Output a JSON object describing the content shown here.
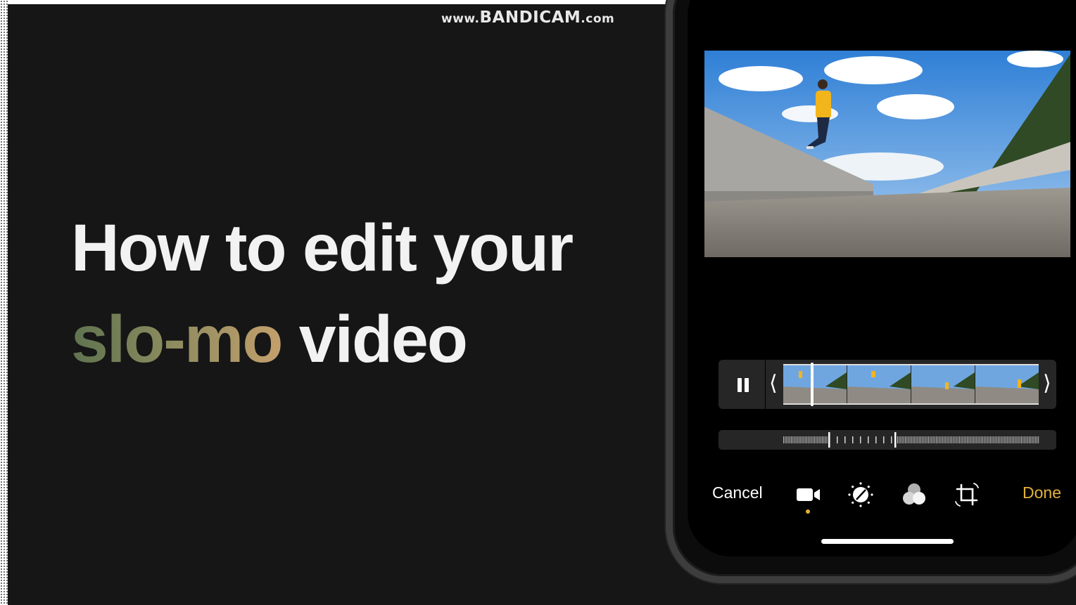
{
  "watermark": {
    "prefix": "www.",
    "brand": "BANDICAM",
    "suffix": ".com"
  },
  "headline": {
    "line1": "How to edit your",
    "line2_highlight": "slo-mo",
    "line2_rest": " video"
  },
  "editor": {
    "toolbar": {
      "cancel_label": "Cancel",
      "done_label": "Done",
      "tools": [
        "video-icon",
        "adjust-icon",
        "filters-icon",
        "crop-icon"
      ],
      "active_tool": "video-icon"
    },
    "colors": {
      "accent": "#e3b13a",
      "background": "#000000"
    }
  }
}
